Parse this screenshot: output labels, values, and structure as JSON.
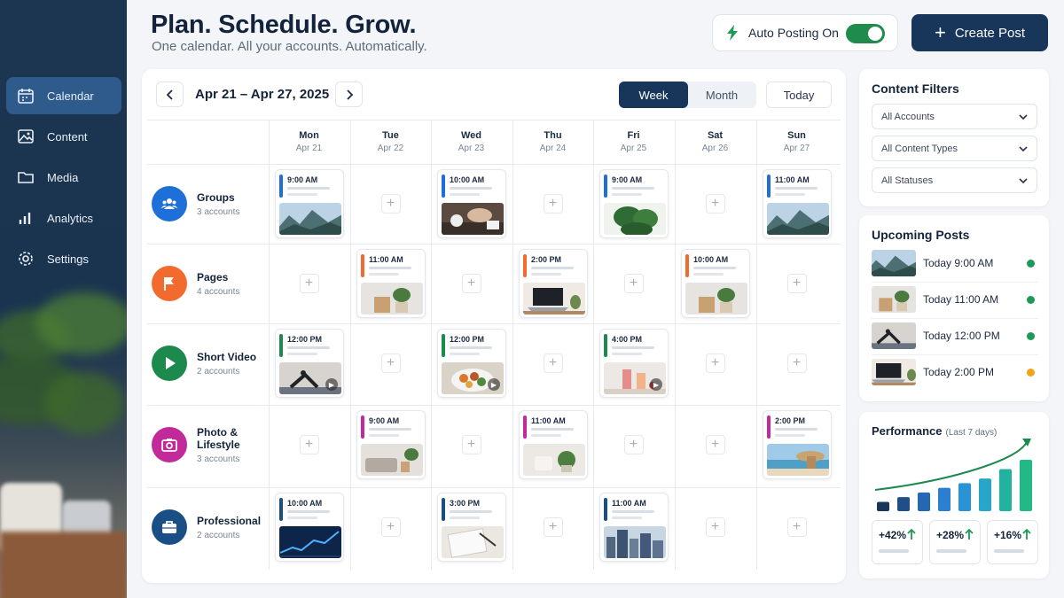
{
  "header": {
    "title": "Plan. Schedule. Grow.",
    "subtitle": "One calendar. All your accounts. Automatically.",
    "auto_posting_label": "Auto Posting On",
    "auto_posting_on": true,
    "create_post_label": "Create Post"
  },
  "sidebar": {
    "items": [
      {
        "label": "Calendar",
        "icon": "calendar-icon",
        "active": true
      },
      {
        "label": "Content",
        "icon": "image-icon",
        "active": false
      },
      {
        "label": "Media",
        "icon": "folder-icon",
        "active": false
      },
      {
        "label": "Analytics",
        "icon": "bar-chart-icon",
        "active": false
      },
      {
        "label": "Settings",
        "icon": "gear-icon",
        "active": false
      }
    ]
  },
  "calendar": {
    "range": "Apr 21 – Apr 27, 2025",
    "views": [
      "Week",
      "Month"
    ],
    "active_view": "Week",
    "today_label": "Today",
    "days": [
      {
        "day": "Mon",
        "date": "Apr 21"
      },
      {
        "day": "Tue",
        "date": "Apr 22"
      },
      {
        "day": "Wed",
        "date": "Apr 23"
      },
      {
        "day": "Thu",
        "date": "Apr 24"
      },
      {
        "day": "Fri",
        "date": "Apr 25"
      },
      {
        "day": "Sat",
        "date": "Apr 26"
      },
      {
        "day": "Sun",
        "date": "Apr 27"
      }
    ],
    "rows": [
      {
        "name": "Groups",
        "accounts": "3 accounts",
        "color": "#1f6fd8",
        "icon": "users-icon",
        "posts": [
          {
            "day": 0,
            "time": "9:00 AM",
            "img": "mountains"
          },
          {
            "day": 2,
            "time": "10:00 AM",
            "img": "coffee-meeting"
          },
          {
            "day": 4,
            "time": "9:00 AM",
            "img": "monstera"
          },
          {
            "day": 6,
            "time": "11:00 AM",
            "img": "mountains"
          }
        ]
      },
      {
        "name": "Pages",
        "accounts": "4 accounts",
        "color": "#f26a2e",
        "icon": "flag-icon",
        "posts": [
          {
            "day": 1,
            "time": "11:00 AM",
            "img": "box-plant"
          },
          {
            "day": 3,
            "time": "2:00 PM",
            "img": "laptop"
          },
          {
            "day": 5,
            "time": "10:00 AM",
            "img": "box-plant"
          }
        ]
      },
      {
        "name": "Short Video",
        "accounts": "2 accounts",
        "color": "#1d8a4d",
        "icon": "play-icon",
        "posts": [
          {
            "day": 0,
            "time": "12:00 PM",
            "img": "yoga",
            "video": true
          },
          {
            "day": 2,
            "time": "12:00 PM",
            "img": "food",
            "video": true
          },
          {
            "day": 4,
            "time": "4:00 PM",
            "img": "smoothie",
            "video": true
          }
        ]
      },
      {
        "name": "Photo & Lifestyle",
        "accounts": "3 accounts",
        "color": "#c2299a",
        "icon": "camera-icon",
        "posts": [
          {
            "day": 1,
            "time": "9:00 AM",
            "img": "sofa"
          },
          {
            "day": 3,
            "time": "11:00 AM",
            "img": "mug"
          },
          {
            "day": 6,
            "time": "2:00 PM",
            "img": "beach"
          }
        ]
      },
      {
        "name": "Professional",
        "accounts": "2 accounts",
        "color": "#1a4f86",
        "icon": "briefcase-icon",
        "posts": [
          {
            "day": 0,
            "time": "10:00 AM",
            "img": "chart"
          },
          {
            "day": 2,
            "time": "3:00 PM",
            "img": "notebook"
          },
          {
            "day": 4,
            "time": "11:00 AM",
            "img": "city"
          }
        ]
      }
    ]
  },
  "filters": {
    "title": "Content Filters",
    "options": [
      "All Accounts",
      "All Content Types",
      "All Statuses"
    ]
  },
  "upcoming": {
    "title": "Upcoming Posts",
    "items": [
      {
        "text": "Today  9:00 AM",
        "img": "mountains",
        "status": "#1d9a55"
      },
      {
        "text": "Today  11:00 AM",
        "img": "box-plant",
        "status": "#1d9a55"
      },
      {
        "text": "Today  12:00 PM",
        "img": "yoga",
        "status": "#1d9a55"
      },
      {
        "text": "Today  2:00 PM",
        "img": "laptop",
        "status": "#f0a417"
      }
    ]
  },
  "performance": {
    "title": "Performance",
    "period": "(Last 7 days)",
    "bars": [
      2,
      3,
      4,
      5,
      6,
      7,
      9,
      11
    ],
    "stats": [
      "+42%",
      "+28%",
      "+16%"
    ]
  }
}
